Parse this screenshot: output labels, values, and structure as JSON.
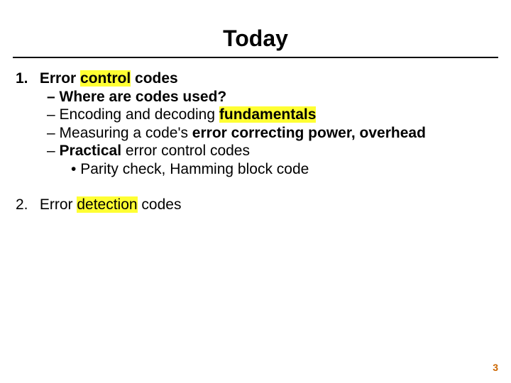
{
  "title": "Today",
  "item1": {
    "num": "1.",
    "pre": "Error ",
    "hl": "control",
    "post": " codes",
    "sub1": {
      "dash": "–  ",
      "text": "Where are codes used?"
    },
    "sub2": {
      "dash": "– ",
      "pre": "Encoding and decoding ",
      "hl": "fundamentals"
    },
    "sub3": {
      "dash": "– ",
      "pre": "Measuring a code's ",
      "bold": "error correcting power, overhead"
    },
    "sub4": {
      "dash": "– ",
      "bold": "Practical",
      "post": " error control codes"
    },
    "sub5": {
      "bullet": "•  ",
      "text": "Parity check, Hamming block code"
    }
  },
  "item2": {
    "num": "2.",
    "pre": "Error ",
    "hl": "detection",
    "post": " codes"
  },
  "page_number": "3"
}
